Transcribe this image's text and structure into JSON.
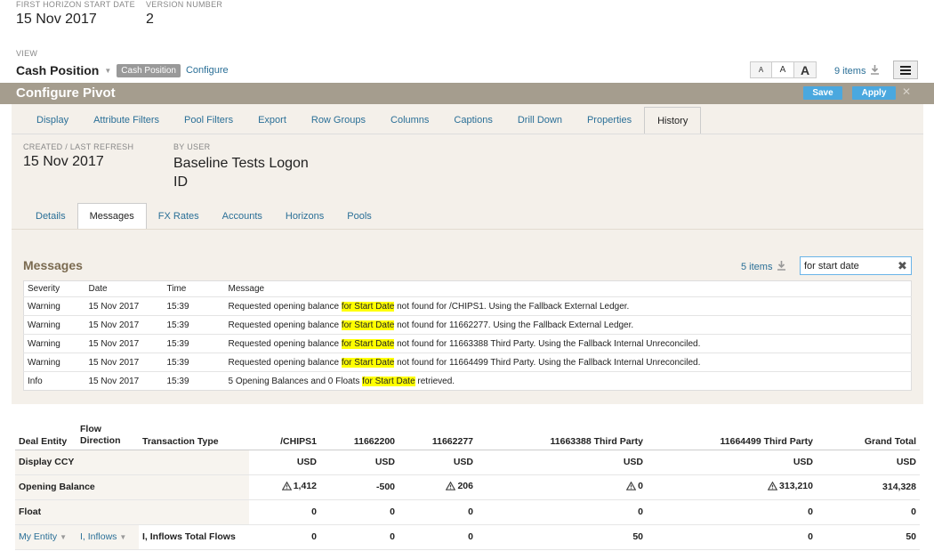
{
  "header": {
    "first_horizon_label": "FIRST HORIZON START DATE",
    "first_horizon_value": "15 Nov 2017",
    "version_label": "VERSION NUMBER",
    "version_value": "2",
    "view_label": "VIEW",
    "view_name": "Cash Position",
    "view_chip": "Cash Position",
    "configure_link": "Configure",
    "font_small": "A",
    "font_medium": "A",
    "font_large": "A",
    "items_count": "9 items"
  },
  "pivot_bar": {
    "title": "Configure Pivot",
    "save": "Save",
    "apply": "Apply"
  },
  "main_tabs": [
    "Display",
    "Attribute Filters",
    "Pool Filters",
    "Export",
    "Row Groups",
    "Columns",
    "Captions",
    "Drill Down",
    "Properties",
    "History"
  ],
  "history": {
    "created_label": "CREATED / LAST REFRESH",
    "created_value": "15 Nov 2017",
    "user_label": "BY USER",
    "user_value": "Baseline Tests Logon ID"
  },
  "sub_tabs": [
    "Details",
    "Messages",
    "FX Rates",
    "Accounts",
    "Horizons",
    "Pools"
  ],
  "messages": {
    "title": "Messages",
    "items_count": "5 items",
    "search_value": "for start date",
    "columns": [
      "Severity",
      "Date",
      "Time",
      "Message"
    ],
    "rows": [
      {
        "severity": "Warning",
        "date": "15 Nov 2017",
        "time": "15:39",
        "pre": "Requested opening balance ",
        "hl": "for Start Date",
        "post": " not found for /CHIPS1. Using the Fallback External Ledger."
      },
      {
        "severity": "Warning",
        "date": "15 Nov 2017",
        "time": "15:39",
        "pre": "Requested opening balance ",
        "hl": "for Start Date",
        "post": " not found for 11662277. Using the Fallback External Ledger."
      },
      {
        "severity": "Warning",
        "date": "15 Nov 2017",
        "time": "15:39",
        "pre": "Requested opening balance ",
        "hl": "for Start Date",
        "post": " not found for 11663388 Third Party. Using the Fallback Internal Unreconciled."
      },
      {
        "severity": "Warning",
        "date": "15 Nov 2017",
        "time": "15:39",
        "pre": "Requested opening balance ",
        "hl": "for Start Date",
        "post": " not found for 11664499 Third Party. Using the Fallback Internal Unreconciled."
      },
      {
        "severity": "Info",
        "date": "15 Nov 2017",
        "time": "15:39",
        "pre": "5 Opening Balances and 0 Floats ",
        "hl": "for Start Date",
        "post": " retrieved."
      }
    ]
  },
  "grid": {
    "h_deal_entity": "Deal Entity",
    "h_flow_direction": "Flow Direction",
    "h_transaction_type": "Transaction Type",
    "columns": [
      "/CHIPS1",
      "11662200",
      "11662277",
      "11663388 Third Party",
      "11664499 Third Party",
      "Grand Total"
    ],
    "display_ccy_label": "Display CCY",
    "display_ccy": [
      "USD",
      "USD",
      "USD",
      "USD",
      "USD",
      "USD"
    ],
    "opening_label": "Opening Balance",
    "opening": [
      "1,412",
      "-500",
      "206",
      "0",
      "313,210",
      "314,328"
    ],
    "float_label": "Float",
    "float": [
      "0",
      "0",
      "0",
      "0",
      "0",
      "0"
    ],
    "entity_link": "My Entity",
    "flow_link": "I, Inflows",
    "flows_label": "I, Inflows Total Flows",
    "flows": [
      "0",
      "0",
      "0",
      "50",
      "0",
      "50"
    ]
  }
}
